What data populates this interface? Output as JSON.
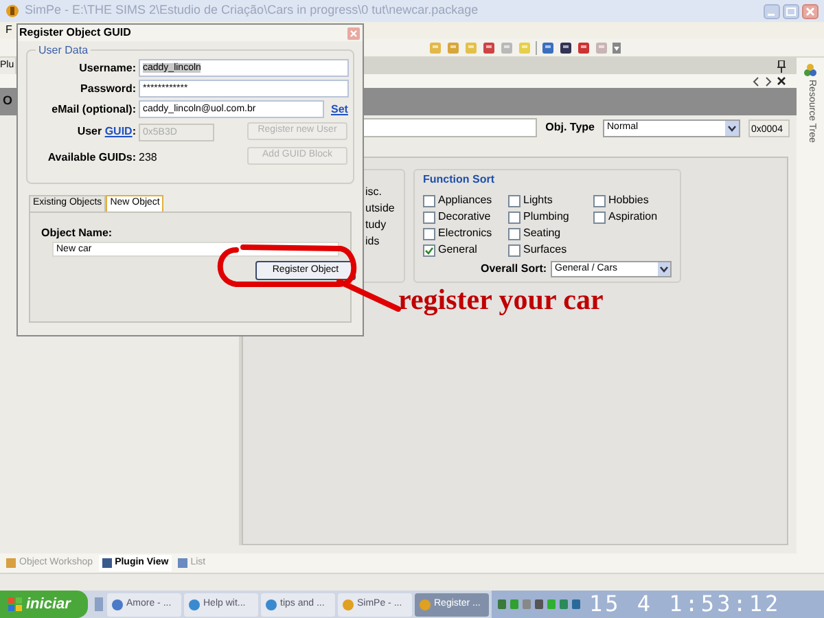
{
  "window": {
    "title": "SimPe - E:\\THE SIMS 2\\Estudio de Criação\\Cars in progress\\0 tut\\newcar.package",
    "menu": [
      "F"
    ]
  },
  "dock_tab": "Plu",
  "plugin": {
    "heading": "O",
    "type_label": "Obj. Type",
    "type_value": "Normal",
    "type_code": "0x0004"
  },
  "room_sort": [
    "isc.",
    "utside",
    "tudy",
    "ids"
  ],
  "function_sort": {
    "title": "Function Sort",
    "overall_label": "Overall Sort:",
    "overall_value": "General / Cars",
    "options": [
      {
        "label": "Appliances",
        "checked": false
      },
      {
        "label": "Decorative",
        "checked": false
      },
      {
        "label": "Electronics",
        "checked": false
      },
      {
        "label": "General",
        "checked": true
      },
      {
        "label": "Lights",
        "checked": false
      },
      {
        "label": "Plumbing",
        "checked": false
      },
      {
        "label": "Seating",
        "checked": false
      },
      {
        "label": "Surfaces",
        "checked": false
      },
      {
        "label": "Hobbies",
        "checked": false
      },
      {
        "label": "Aspiration",
        "checked": false
      }
    ]
  },
  "side_tab": "Resource Tree",
  "bottom_tabs": [
    {
      "label": "Object Workshop",
      "selected": false
    },
    {
      "label": "Plugin View",
      "selected": true
    },
    {
      "label": "List",
      "selected": false
    }
  ],
  "dialog": {
    "title": "Register Object GUID",
    "group": "User Data",
    "username_label": "Username:",
    "username": "caddy_lincoln",
    "password_label": "Password:",
    "password": "************",
    "email_label": "eMail (optional):",
    "email": "caddy_lincoln@uol.com.br",
    "set_link": "Set",
    "guid_label_start": "User ",
    "guid_link": "GUID",
    ":guid_colon": ":",
    "guid_value": "0x5B3D",
    "register_user_button": "Register new User",
    "add_block_button": "Add GUID Block",
    "available_label": "Available GUIDs:",
    "available_value": "238",
    "tabs": [
      {
        "label": "Existing Objects",
        "selected": false
      },
      {
        "label": "New Object",
        "selected": true
      }
    ],
    "object_name_label": "Object Name:",
    "object_name": "New car",
    "register_button": "Register Object"
  },
  "annotation": "register your car",
  "taskbar": {
    "start": "iniciar",
    "tasks": [
      {
        "label": "Amore - ...",
        "selected": false
      },
      {
        "label": "Help wit...",
        "selected": false
      },
      {
        "label": "tips and ...",
        "selected": false
      },
      {
        "label": "SimPe - ...",
        "selected": false
      },
      {
        "label": "Register ...",
        "selected": true
      }
    ],
    "clock": "15 4 1:53:12"
  }
}
